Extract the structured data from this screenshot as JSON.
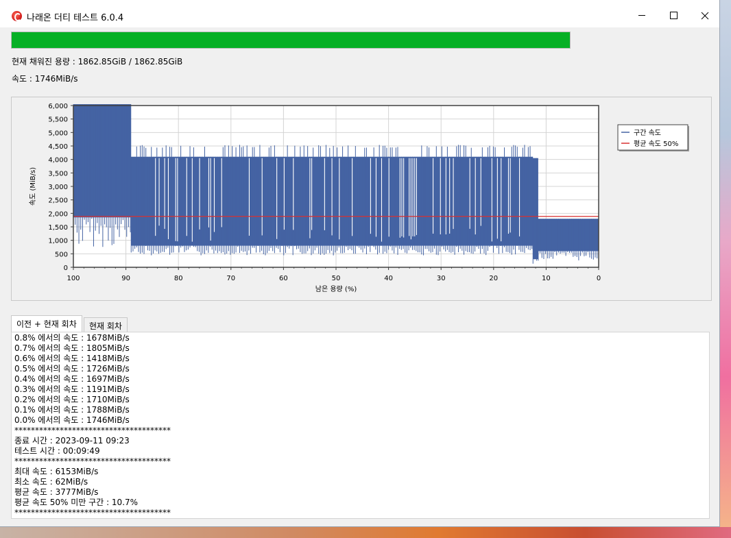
{
  "window": {
    "title": "나래온 더티 테스트 6.0.4"
  },
  "progress": {
    "fraction": 1.0,
    "color": "#06b025"
  },
  "status": {
    "capacity_line": "현재 채워진 용량 : 1862.85GiB / 1862.85GiB",
    "speed_line": "속도 : 1746MiB/s"
  },
  "chart_data": {
    "type": "area",
    "xlabel": "남은 용량 (%)",
    "ylabel": "속도 (MiB/s)",
    "xlim": [
      100,
      0
    ],
    "ylim": [
      0,
      6000
    ],
    "x_ticks": [
      "100",
      "90",
      "80",
      "70",
      "60",
      "50",
      "40",
      "30",
      "20",
      "10",
      "0"
    ],
    "y_ticks": [
      "6,000",
      "5,500",
      "5,000",
      "4,500",
      "4,000",
      "3,500",
      "3,000",
      "2,500",
      "2,000",
      "1,500",
      "1,000",
      "500",
      "0"
    ],
    "grid": true,
    "legend": {
      "placement": "right",
      "entries": [
        "구간 속도",
        "평균 속도 50%"
      ]
    },
    "series": [
      {
        "name": "구간 속도",
        "color": "#4463a3",
        "segments": [
          {
            "from": 100,
            "to": 89,
            "high": 6050,
            "low": 1850
          },
          {
            "from": 89,
            "to": 12.5,
            "high": 4100,
            "low": 800,
            "peaks_to": 4550
          },
          {
            "from": 12.5,
            "to": 11.5,
            "high": 4050,
            "low": 300
          },
          {
            "from": 11.5,
            "to": 0,
            "high": 1800,
            "low": 600
          }
        ]
      },
      {
        "name": "평균 속도 50%",
        "color": "#d93030",
        "value": 1888
      }
    ]
  },
  "tabs": [
    {
      "label": "이전 + 현재 회차",
      "active": true
    },
    {
      "label": "현재 회차",
      "active": false
    }
  ],
  "log": [
    "0.8% 에서의 속도 : 1678MiB/s",
    "0.7% 에서의 속도 : 1805MiB/s",
    "0.6% 에서의 속도 : 1418MiB/s",
    "0.5% 에서의 속도 : 1726MiB/s",
    "0.4% 에서의 속도 : 1697MiB/s",
    "0.3% 에서의 속도 : 1191MiB/s",
    "0.2% 에서의 속도 : 1710MiB/s",
    "0.1% 에서의 속도 : 1788MiB/s",
    "0.0% 에서의 속도 : 1746MiB/s",
    "**************************************",
    "종료 시간 : 2023-09-11 09:23",
    "테스트 시간 : 00:09:49",
    "**************************************",
    "최대 속도 : 6153MiB/s",
    "최소 속도 : 62MiB/s",
    "평균 속도 : 3777MiB/s",
    "평균 속도 50% 미만 구간 : 10.7%",
    "**************************************"
  ]
}
